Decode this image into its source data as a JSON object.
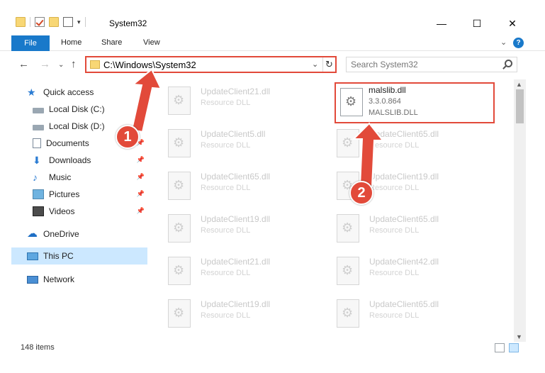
{
  "window": {
    "title": "System32",
    "minimize_glyph": "—",
    "maximize_glyph": "☐",
    "close_glyph": "✕"
  },
  "quick_access_toolbar": {
    "dropdown_glyph": "▾"
  },
  "ribbon": {
    "tabs": [
      "File",
      "Home",
      "Share",
      "View"
    ],
    "expand_glyph": "⌄",
    "help_glyph": "?"
  },
  "navigation": {
    "back_glyph": "←",
    "forward_glyph": "→",
    "recent_glyph": "⌄",
    "up_glyph": "↑"
  },
  "address_bar": {
    "path": "C:\\Windows\\System32",
    "dropdown_glyph": "⌄",
    "refresh_glyph": "↻",
    "highlight_color": "#e24a3a"
  },
  "search": {
    "placeholder": "Search System32"
  },
  "sidebar": {
    "items": [
      {
        "label": "Quick access",
        "icon": "star-icon"
      },
      {
        "label": "Local Disk (C:)",
        "icon": "disk-icon",
        "pinned": true
      },
      {
        "label": "Local Disk (D:)",
        "icon": "disk-icon",
        "pinned": true
      },
      {
        "label": "Documents",
        "icon": "documents-icon",
        "pinned": true
      },
      {
        "label": "Downloads",
        "icon": "download-icon",
        "pinned": true
      },
      {
        "label": "Music",
        "icon": "music-icon",
        "pinned": true
      },
      {
        "label": "Pictures",
        "icon": "pictures-icon",
        "pinned": true
      },
      {
        "label": "Videos",
        "icon": "videos-icon",
        "pinned": true
      },
      {
        "label": "OneDrive",
        "icon": "onedrive-icon"
      },
      {
        "label": "This PC",
        "icon": "computer-icon",
        "selected": true
      },
      {
        "label": "Network",
        "icon": "network-icon"
      }
    ],
    "pin_glyph": "📌"
  },
  "files": {
    "highlighted": {
      "name": "malslib.dll",
      "version": "3.3.0.864",
      "description": "MALSLIB.DLL"
    },
    "left_column": [
      {
        "name": "UpdateClient21.dll",
        "type": "Resource DLL"
      },
      {
        "name": "UpdateClient5.dll",
        "type": "Resource DLL"
      },
      {
        "name": "UpdateClient65.dll",
        "type": "Resource DLL"
      },
      {
        "name": "UpdateClient19.dll",
        "type": "Resource DLL"
      },
      {
        "name": "UpdateClient21.dll",
        "type": "Resource DLL"
      },
      {
        "name": "UpdateClient19.dll",
        "type": "Resource DLL"
      }
    ],
    "right_column": [
      {
        "name": "UpdateClient65.dll",
        "type": "Resource DLL"
      },
      {
        "name": "UpdateClient19.dll",
        "type": "Resource DLL"
      },
      {
        "name": "UpdateClient65.dll",
        "type": "Resource DLL"
      },
      {
        "name": "UpdateClient42.dll",
        "type": "Resource DLL"
      },
      {
        "name": "UpdateClient65.dll",
        "type": "Resource DLL"
      }
    ]
  },
  "scrollbar": {
    "up_glyph": "▲",
    "down_glyph": "▼"
  },
  "status_bar": {
    "item_count": "148 items"
  },
  "annotations": {
    "callouts": [
      "1",
      "2"
    ],
    "color": "#e24a3a"
  }
}
